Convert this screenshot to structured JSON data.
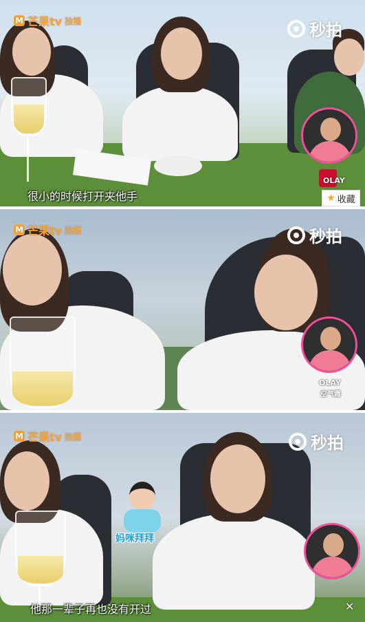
{
  "watermark": {
    "channel_logo": "芒果tv",
    "channel_logo_tag": "独播",
    "miaopai": "秒拍"
  },
  "panels": [
    {
      "caption": "很小的时候打开夹他手",
      "favorite_label": "收藏",
      "product": "OLAY"
    },
    {
      "caption": "",
      "product": "OLAY",
      "product_sub": "空气霜"
    },
    {
      "caption": "他那一辈子再也没有开过",
      "sticker_text": "妈咪拜拜"
    }
  ],
  "colors": {
    "logo_orange": "#f6a33a",
    "avatar_ring": "#f14f9b",
    "fav_star": "#f5a623"
  },
  "icons": [
    "mango-tv-logo-icon",
    "miaopai-logo-icon",
    "star-icon",
    "mute-icon"
  ]
}
